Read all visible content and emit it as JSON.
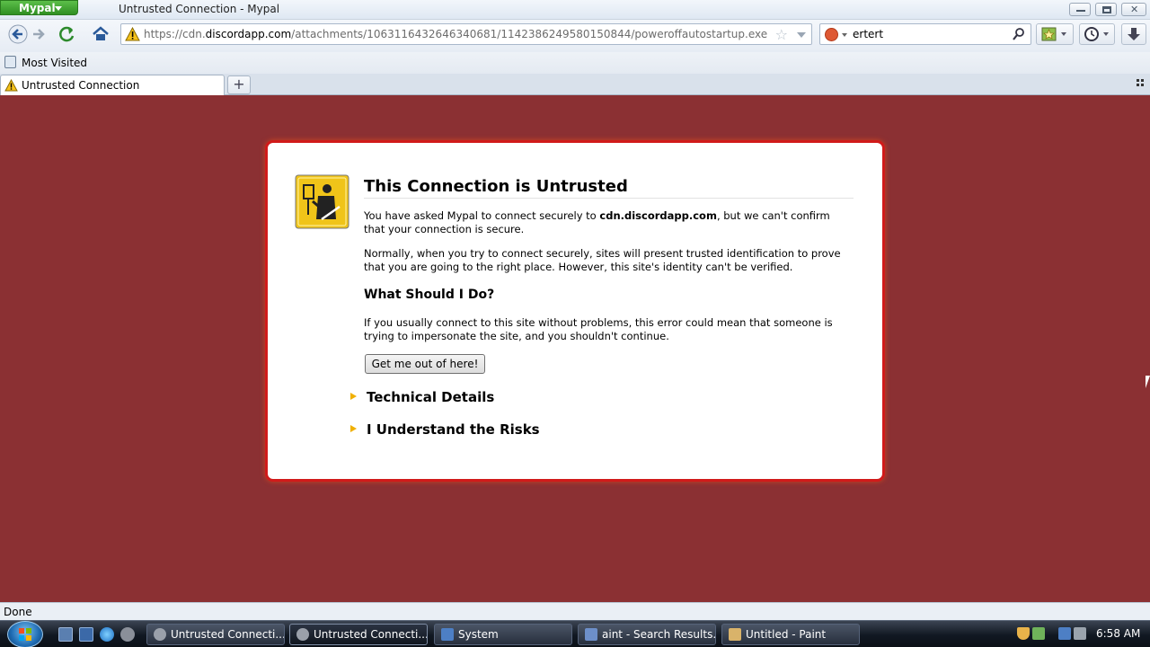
{
  "window": {
    "app_button": "Mypal",
    "title": "Untrusted Connection - Mypal"
  },
  "navbar": {
    "url_prefix": "https://cdn.",
    "url_domain": "discordapp.com",
    "url_rest": "/attachments/1063116432646340681/1142386249580150844/poweroffautostartup.exe",
    "search_value": "ertert"
  },
  "bookmarks": {
    "items": [
      {
        "label": "Most Visited"
      }
    ]
  },
  "tabs": {
    "items": [
      {
        "label": "Untrusted Connection"
      }
    ]
  },
  "error": {
    "title": "This Connection is Untrusted",
    "para1_before": "You have asked Mypal to connect securely to ",
    "para1_host": "cdn.discordapp.com",
    "para1_after": ", but we can't confirm that your connection is secure.",
    "para2": "Normally, when you try to connect securely, sites will present trusted identification to prove that you are going to the right place. However, this site's identity can't be verified.",
    "subtitle": "What Should I Do?",
    "para3": "If you usually connect to this site without problems, this error could mean that someone is trying to impersonate the site, and you shouldn't continue.",
    "button_label": "Get me out of here!",
    "expanders": [
      {
        "label": "Technical Details"
      },
      {
        "label": "I Understand the Risks"
      }
    ]
  },
  "status": {
    "text": "Done"
  },
  "taskbar": {
    "tasks": [
      {
        "label": "Untrusted Connecti..."
      },
      {
        "label": "Untrusted Connecti..."
      },
      {
        "label": "System"
      },
      {
        "label": "aint - Search Results..."
      },
      {
        "label": "Untitled - Paint"
      }
    ],
    "clock": "6:58 AM"
  },
  "colors": {
    "page_background": "#8b3033",
    "error_border": "#d11a1a",
    "app_button": "#3ea22e"
  }
}
